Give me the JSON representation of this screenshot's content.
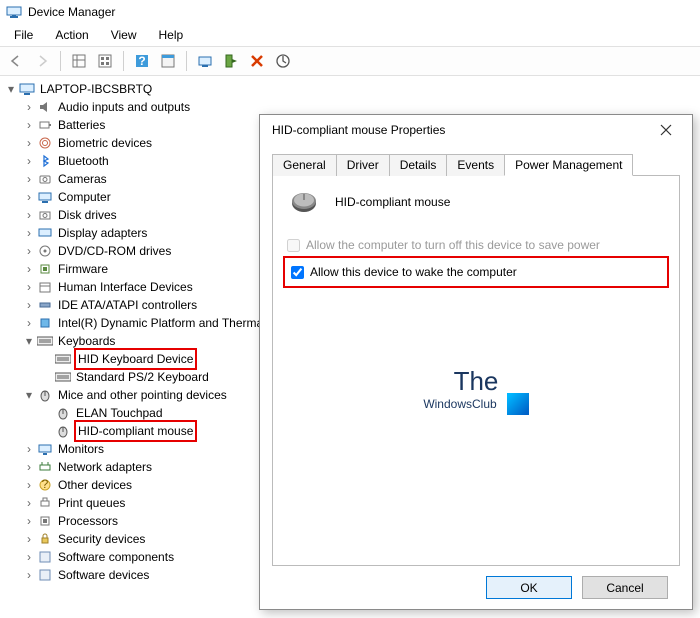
{
  "app": {
    "title": "Device Manager"
  },
  "menu": {
    "file": "File",
    "action": "Action",
    "view": "View",
    "help": "Help"
  },
  "root": {
    "label": "LAPTOP-IBCSBRTQ"
  },
  "nodes": {
    "audio": "Audio inputs and outputs",
    "batteries": "Batteries",
    "biometric": "Biometric devices",
    "bluetooth": "Bluetooth",
    "cameras": "Cameras",
    "computer": "Computer",
    "disk": "Disk drives",
    "display": "Display adapters",
    "dvd": "DVD/CD-ROM drives",
    "firmware": "Firmware",
    "hid": "Human Interface Devices",
    "ide": "IDE ATA/ATAPI controllers",
    "intel": "Intel(R) Dynamic Platform and Thermal Framework",
    "keyboards": "Keyboards",
    "kb_hid": "HID Keyboard Device",
    "kb_ps2": "Standard PS/2 Keyboard",
    "mice": "Mice and other pointing devices",
    "m_elan": "ELAN Touchpad",
    "m_hid": "HID-compliant mouse",
    "monitors": "Monitors",
    "network": "Network adapters",
    "other": "Other devices",
    "print": "Print queues",
    "proc": "Processors",
    "security": "Security devices",
    "softcomp": "Software components",
    "softdev": "Software devices"
  },
  "dialog": {
    "title": "HID-compliant mouse Properties",
    "tabs": {
      "general": "General",
      "driver": "Driver",
      "details": "Details",
      "events": "Events",
      "power": "Power Management"
    },
    "device_name": "HID-compliant mouse",
    "cb_turnoff": "Allow the computer to turn off this device to save power",
    "cb_wake": "Allow this device to wake the computer",
    "ok": "OK",
    "cancel": "Cancel"
  },
  "watermark": {
    "line1": "The",
    "line2": "WindowsClub"
  }
}
